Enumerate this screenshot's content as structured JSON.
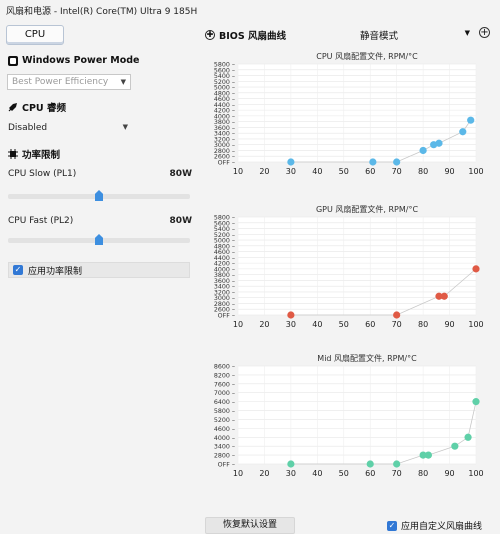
{
  "titlebar": {
    "title": "风扇和电源 - Intel(R) Core(TM) Ultra 9 185H"
  },
  "left": {
    "cpu_button": "CPU",
    "power_mode": {
      "heading": "Windows Power Mode",
      "selected": "Best Power Efficiency"
    },
    "cpu_boost": {
      "heading": "CPU 睿频",
      "selected": "Disabled"
    },
    "power_limit": {
      "heading": "功率限制",
      "pl1": {
        "label": "CPU Slow (PL1)",
        "value": "80W",
        "slider_fraction": 0.5
      },
      "pl2": {
        "label": "CPU Fast (PL2)",
        "value": "80W",
        "slider_fraction": 0.5
      },
      "apply_label": "应用功率限制"
    }
  },
  "right": {
    "heading": "BIOS 风扇曲线",
    "mode_selected": "静音模式"
  },
  "chart_data": [
    {
      "type": "line",
      "title": "CPU 风扇配置文件, RPM/°C",
      "color": "#5bb8e8",
      "x_ticks": [
        "10",
        "20",
        "30",
        "40",
        "50",
        "60",
        "70",
        "80",
        "90",
        "100"
      ],
      "y_ticks": [
        "OFF",
        "2600",
        "2800",
        "3000",
        "3200",
        "3400",
        "3600",
        "3800",
        "4000",
        "4200",
        "4400",
        "4600",
        "4800",
        "5000",
        "5200",
        "5400",
        "5600",
        "5800"
      ],
      "xlim": [
        10,
        100
      ],
      "points": [
        [
          30,
          "OFF"
        ],
        [
          61,
          "OFF"
        ],
        [
          70,
          "OFF"
        ],
        [
          80,
          2800
        ],
        [
          84,
          3000
        ],
        [
          86,
          3050
        ],
        [
          95,
          3450
        ],
        [
          98,
          3850
        ]
      ]
    },
    {
      "type": "line",
      "title": "GPU 风扇配置文件, RPM/°C",
      "color": "#e05a45",
      "x_ticks": [
        "10",
        "20",
        "30",
        "40",
        "50",
        "60",
        "70",
        "80",
        "90",
        "100"
      ],
      "y_ticks": [
        "OFF",
        "2600",
        "2800",
        "3000",
        "3200",
        "3400",
        "3600",
        "3800",
        "4000",
        "4200",
        "4400",
        "4600",
        "4800",
        "5000",
        "5200",
        "5400",
        "5600",
        "5800"
      ],
      "xlim": [
        10,
        100
      ],
      "points": [
        [
          30,
          "OFF"
        ],
        [
          70,
          "OFF"
        ],
        [
          86,
          3050
        ],
        [
          88,
          3050
        ],
        [
          100,
          4000
        ]
      ]
    },
    {
      "type": "line",
      "title": "Mid 风扇配置文件, RPM/°C",
      "color": "#5fd0a8",
      "x_ticks": [
        "10",
        "20",
        "30",
        "40",
        "50",
        "60",
        "70",
        "80",
        "90",
        "100"
      ],
      "y_ticks": [
        "OFF",
        "2800",
        "3400",
        "4000",
        "4600",
        "5200",
        "5800",
        "6400",
        "7000",
        "7600",
        "8200",
        "8600"
      ],
      "xlim": [
        10,
        100
      ],
      "points": [
        [
          30,
          "OFF"
        ],
        [
          60,
          "OFF"
        ],
        [
          70,
          "OFF"
        ],
        [
          80,
          2800
        ],
        [
          82,
          2800
        ],
        [
          92,
          3400
        ],
        [
          97,
          4000
        ],
        [
          100,
          6400
        ]
      ]
    }
  ],
  "footer": {
    "reset_label": "恢复默认设置",
    "apply_custom_label": "应用自定义风扇曲线"
  }
}
